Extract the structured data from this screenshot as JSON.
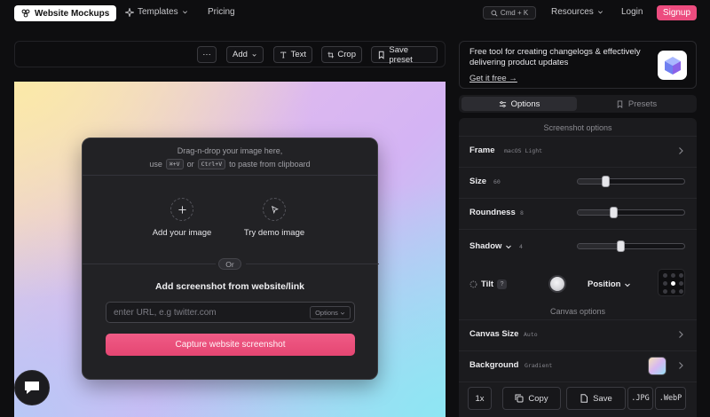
{
  "nav": {
    "brand": "Website Mockups",
    "templates": "Templates",
    "pricing": "Pricing",
    "search_shortcut": "Cmd + K",
    "resources": "Resources",
    "login": "Login",
    "signup": "Signup"
  },
  "toolbar": {
    "more": "···",
    "add": "Add",
    "text": "Text",
    "crop": "Crop",
    "save_preset": "Save preset"
  },
  "card": {
    "drop_line1": "Drag-n-drop your image here,",
    "drop_use": "use",
    "kbd_mac": "⌘+V",
    "drop_or": "or",
    "kbd_win": "Ctrl+V",
    "drop_tail": "to paste from clipboard",
    "add_image": "Add your image",
    "demo_image": "Try demo image",
    "or": "Or",
    "add_from_link": "Add screenshot from website/link",
    "url_placeholder": "enter URL, e.g twitter.com",
    "options": "Options",
    "capture": "Capture website screenshot"
  },
  "promo": {
    "text": "Free tool for creating changelogs & effectively delivering product updates",
    "link": "Get it free →"
  },
  "tabs": {
    "options": "Options",
    "presets": "Presets"
  },
  "panel": {
    "screenshot_options": "Screenshot options",
    "frame_label": "Frame",
    "frame_value": "macOS Light",
    "size_label": "Size",
    "size_value": "60",
    "size_level": 0.27,
    "roundness_label": "Roundness",
    "roundness_value": "8",
    "roundness_level": 0.34,
    "shadow_label": "Shadow",
    "shadow_value": "4",
    "shadow_level": 0.41,
    "tilt_label": "Tilt",
    "tilt_help": "?",
    "position_label": "Position",
    "canvas_options": "Canvas options",
    "canvas_size_label": "Canvas Size",
    "canvas_size_value": "Auto",
    "background_label": "Background",
    "background_value": "Gradient"
  },
  "bottom": {
    "scale": "1x",
    "copy": "Copy",
    "save": "Save",
    "jpg": ".JPG",
    "webp": ".WebP"
  },
  "colors": {
    "accent": "#ec4c7f",
    "capture_button": "#e54672"
  }
}
